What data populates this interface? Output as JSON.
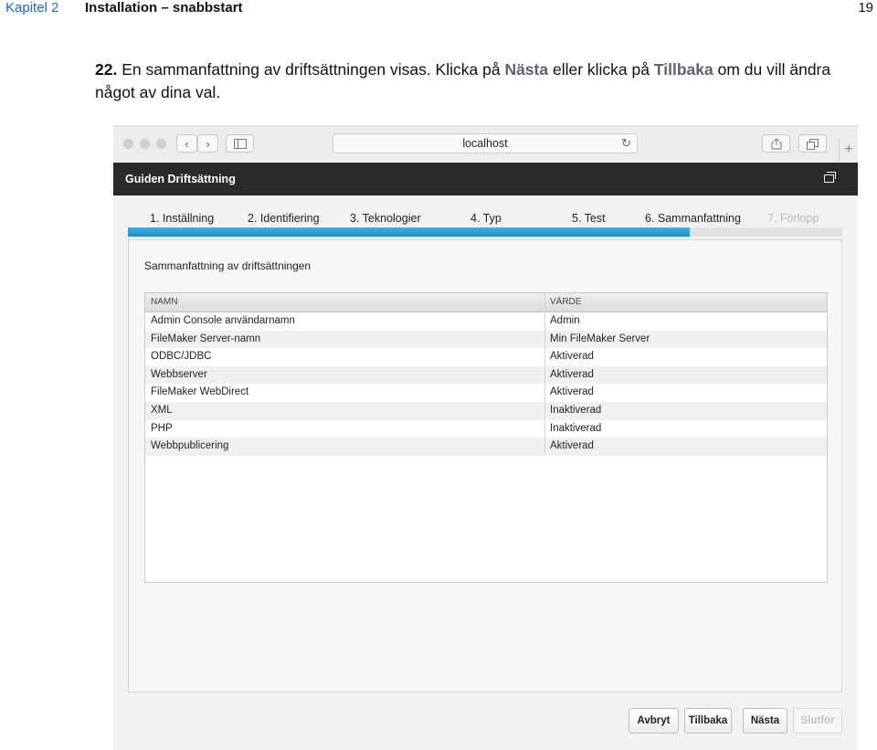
{
  "doc": {
    "chapter": "Kapitel 2",
    "section": "Installation – snabbstart",
    "page": "19"
  },
  "step": {
    "number": "22.",
    "text_before": " En sammanfattning av driftsättningen visas. Klicka på ",
    "next_word": "Nästa",
    "text_middle": " eller klicka på ",
    "back_word": "Tillbaka",
    "text_after": " om du vill ändra något av dina val."
  },
  "browser": {
    "address": "localhost",
    "icons": [
      "back-icon",
      "forward-icon",
      "sidebar-icon",
      "reload-icon",
      "share-icon",
      "tabs-icon",
      "plus-icon"
    ]
  },
  "wizard": {
    "title": "Guiden Driftsättning",
    "steps": [
      {
        "label": "1. Inställning",
        "active": true
      },
      {
        "label": "2. Identifiering",
        "active": true
      },
      {
        "label": "3. Teknologier",
        "active": true
      },
      {
        "label": "4. Typ",
        "active": true
      },
      {
        "label": "5. Test",
        "active": true
      },
      {
        "label": "6. Sammanfattning",
        "active": true
      },
      {
        "label": "7. Förlopp",
        "active": false
      }
    ],
    "progress_fraction": 0.786,
    "progress_color": "#1a8ecf",
    "panel_title": "Sammanfattning av driftsättningen",
    "table": {
      "headers": [
        "NAMN",
        "VÄRDE"
      ],
      "rows": [
        [
          "Admin Console användarnamn",
          "Admin"
        ],
        [
          "FileMaker Server-namn",
          "Min FileMaker Server"
        ],
        [
          "ODBC/JDBC",
          "Aktiverad"
        ],
        [
          "Webbserver",
          "Aktiverad"
        ],
        [
          "FileMaker WebDirect",
          "Aktiverad"
        ],
        [
          "XML",
          "Inaktiverad"
        ],
        [
          "PHP",
          "Inaktiverad"
        ],
        [
          "Webbpublicering",
          "Aktiverad"
        ]
      ]
    },
    "buttons": {
      "cancel": "Avbryt",
      "back": "Tillbaka",
      "next": "Nästa",
      "finish": "Slutför"
    }
  },
  "colors": {
    "chapter_link": "#1a6fc4",
    "titlebar": "#2a2a2a"
  }
}
